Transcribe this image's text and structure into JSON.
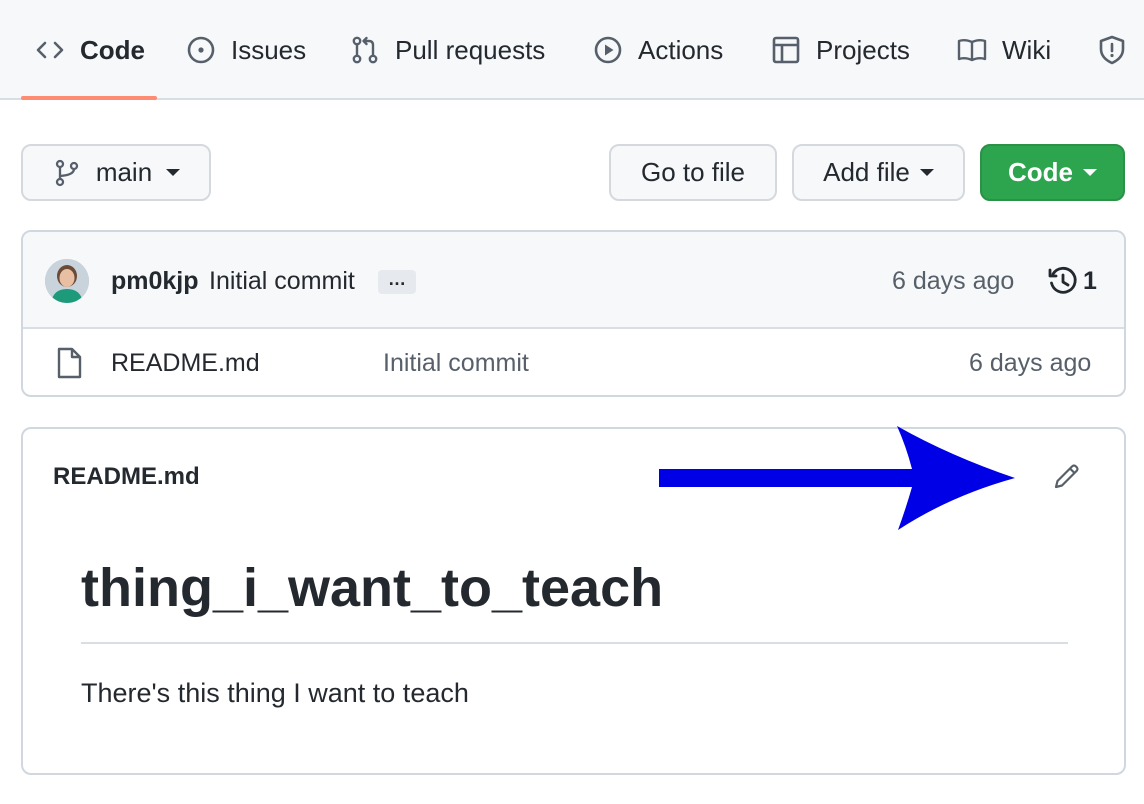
{
  "tabs": [
    {
      "label": "Code",
      "icon": "code-icon",
      "selected": true
    },
    {
      "label": "Issues",
      "icon": "issue-opened-icon"
    },
    {
      "label": "Pull requests",
      "icon": "git-pull-request-icon"
    },
    {
      "label": "Actions",
      "icon": "play-icon"
    },
    {
      "label": "Projects",
      "icon": "table-icon"
    },
    {
      "label": "Wiki",
      "icon": "book-icon"
    },
    {
      "icon": "shield-icon"
    }
  ],
  "toolbar": {
    "branch": "main",
    "go_to_file": "Go to file",
    "add_file": "Add file",
    "code": "Code"
  },
  "commit": {
    "author": "pm0kjp",
    "message": "Initial commit",
    "ellipsis": "…",
    "time": "6 days ago",
    "count": "1"
  },
  "files": [
    {
      "name": "README.md",
      "commit_message": "Initial commit",
      "time": "6 days ago",
      "icon": "file-icon"
    }
  ],
  "readme": {
    "filename": "README.md",
    "heading": "thing_i_want_to_teach",
    "body": "There's this thing I want to teach",
    "edit_icon": "pencil-icon"
  },
  "colors": {
    "accent_underline": "#fd8c73",
    "primary_button": "#2da44e",
    "annotation_arrow": "#0000e6"
  }
}
